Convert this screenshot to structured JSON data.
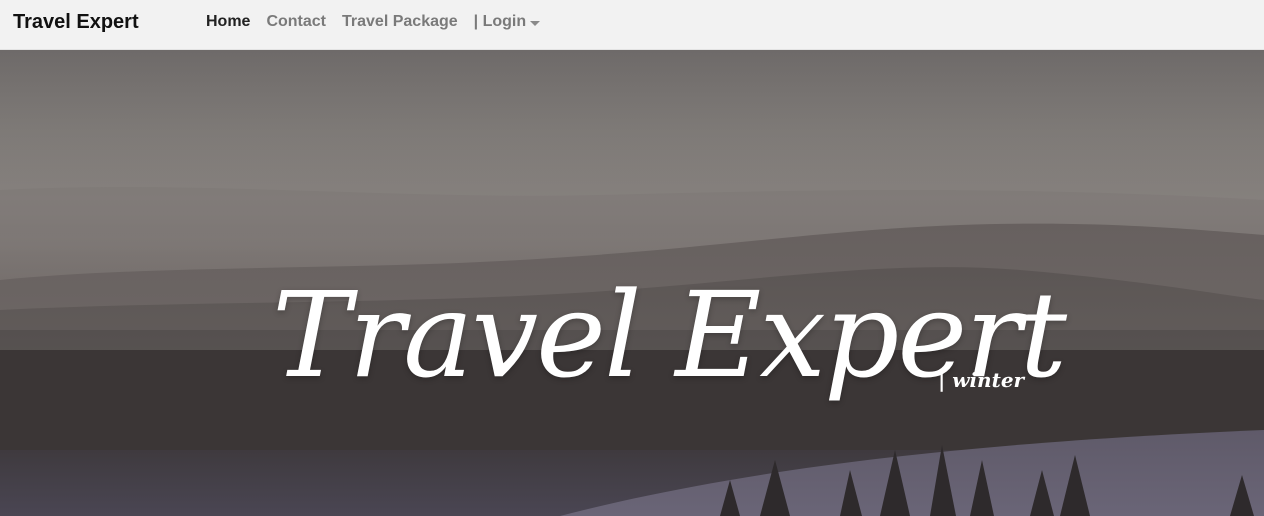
{
  "navbar": {
    "brand": "Travel Expert",
    "links": [
      {
        "label": "Home",
        "active": true
      },
      {
        "label": "Contact",
        "active": false
      },
      {
        "label": "Travel Package",
        "active": false
      }
    ],
    "login_label": "| Login"
  },
  "hero": {
    "title": "Travel Expert",
    "subtitle": "| winter"
  },
  "colors": {
    "navbar_bg": "#f2f2f2",
    "active_link": "#222222",
    "inactive_link": "#7a7a7a",
    "hero_text": "#ffffff"
  }
}
